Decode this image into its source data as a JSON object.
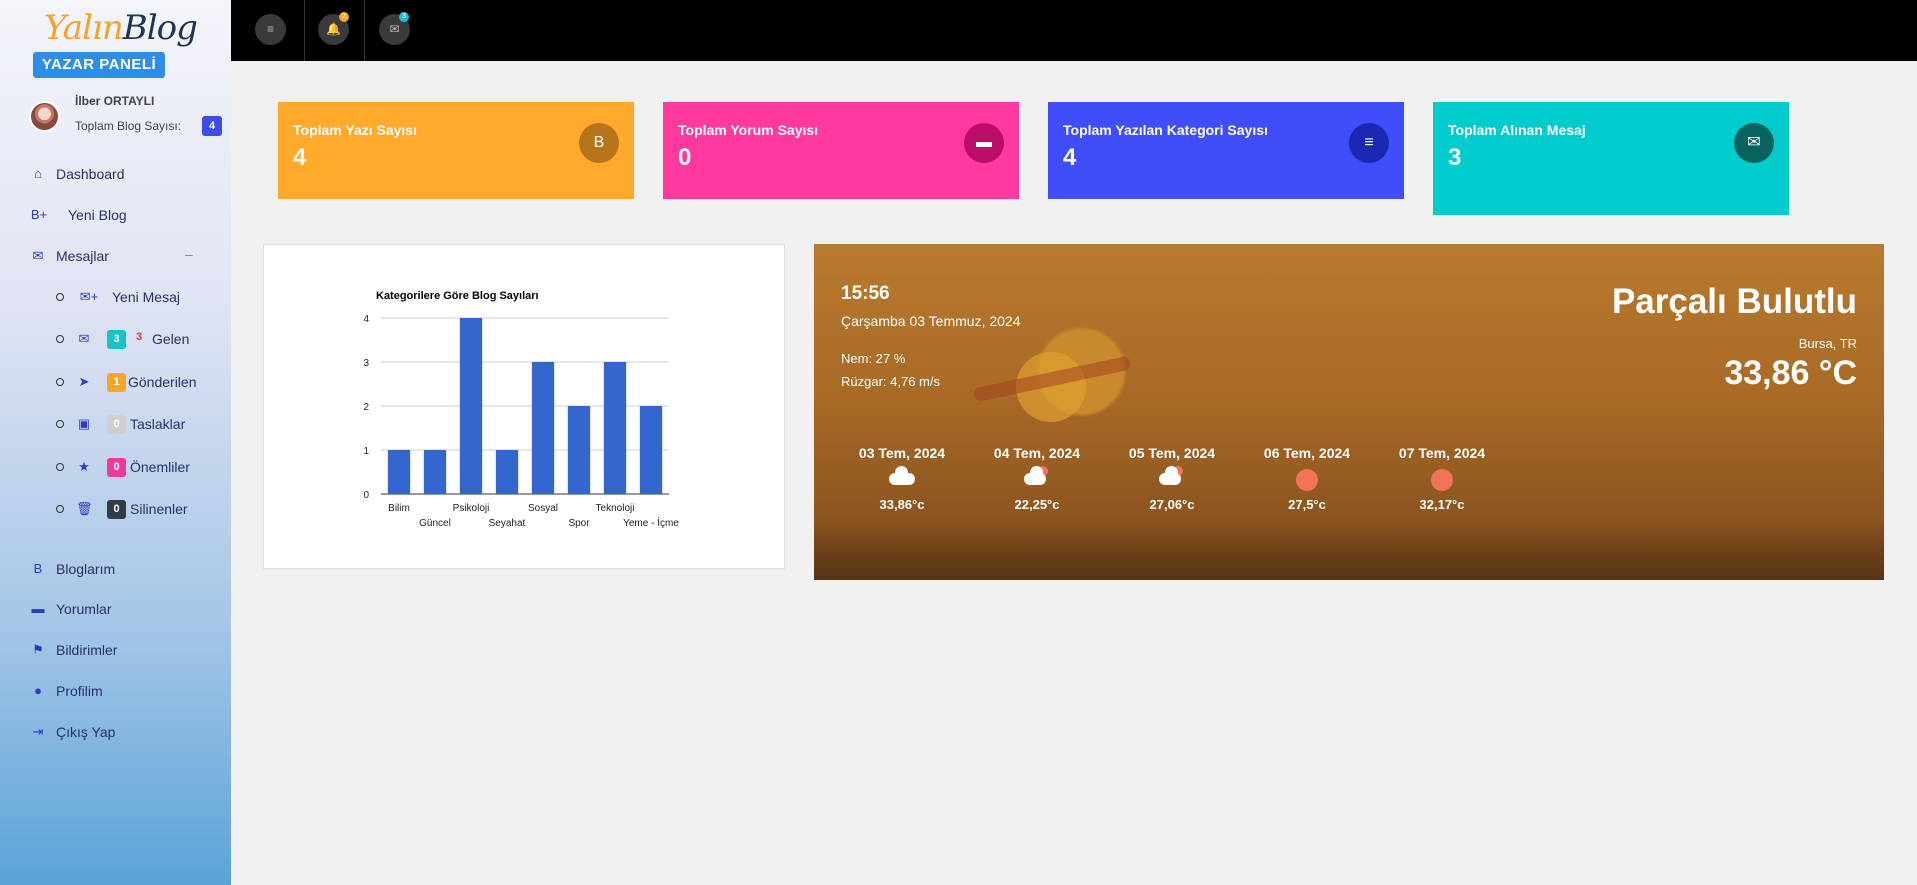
{
  "sidebar": {
    "logo_main": "Yalın",
    "logo_accent": "Blog",
    "panel_label": "YAZAR PANELİ",
    "user_name": "İlber ORTAYLI",
    "blog_count_label": "Toplam Blog Sayısı:",
    "blog_count": "4",
    "menu": [
      {
        "label": "Dashboard",
        "icon": "home-icon"
      },
      {
        "label": "Yeni Blog",
        "icon": "blogger-plus-icon"
      },
      {
        "label": "Mesajlar",
        "icon": "envelope-icon",
        "collapse": "–"
      }
    ],
    "sub_menu": [
      {
        "label": "Yeni Mesaj",
        "icon": "mail-plus-icon"
      },
      {
        "label": "Gelen",
        "icon": "inbox-icon",
        "badge": "3",
        "extra": "3",
        "badge_color": "#18c2c8"
      },
      {
        "label": "Gönderilen",
        "icon": "send-icon",
        "badge": "1",
        "badge_color": "#f5a623"
      },
      {
        "label": "Taslaklar",
        "icon": "save-icon",
        "badge": "0",
        "badge_color": "#cfcfcf"
      },
      {
        "label": "Önemliler",
        "icon": "star-icon",
        "badge": "0",
        "badge_color": "#f0399a"
      },
      {
        "label": "Silinenler",
        "icon": "trash-icon",
        "badge": "0",
        "badge_color": "#333b44"
      }
    ],
    "menu2": [
      {
        "label": "Bloglarım",
        "icon": "blogger-icon"
      },
      {
        "label": "Yorumlar",
        "icon": "comment-icon"
      },
      {
        "label": "Bildirimler",
        "icon": "flag-icon"
      },
      {
        "label": "Profilim",
        "icon": "user-icon"
      },
      {
        "label": "Çıkış Yap",
        "icon": "logout-icon"
      }
    ]
  },
  "topbar": {
    "notification_count": "2",
    "message_count": "3"
  },
  "cards": [
    {
      "title": "Toplam Yazı Sayısı",
      "value": "4",
      "icon": "blogger-icon",
      "color": "#ffaa2b",
      "icon_bg": "#b8741d"
    },
    {
      "title": "Toplam Yorum Sayısı",
      "value": "0",
      "icon": "comment-icon",
      "color": "#ff399e",
      "icon_bg": "#bb0d68"
    },
    {
      "title": "Toplam Yazılan Kategori Sayısı",
      "value": "4",
      "icon": "list-icon",
      "color": "#3f4ef8",
      "icon_bg": "#1d28b2"
    },
    {
      "title": "Toplam Alınan Mesaj",
      "value": "3",
      "icon": "envelope-icon",
      "color": "#00cccd",
      "icon_bg": "#08635f"
    }
  ],
  "chart_data": {
    "type": "bar",
    "title": "Kategorilere Göre Blog Sayıları",
    "categories": [
      "Bilim",
      "Güncel",
      "Psikoloji",
      "Seyahat",
      "Sosyal",
      "Spor",
      "Teknoloji",
      "Yeme - İçme"
    ],
    "values": [
      1,
      1,
      4,
      1,
      3,
      2,
      3,
      2
    ],
    "ylim": [
      0,
      4
    ],
    "yticks": [
      "0",
      "1",
      "2",
      "3",
      "4"
    ],
    "bar_color": "#3366cc",
    "grid": true
  },
  "weather": {
    "time": "15:56",
    "date": "Çarşamba 03 Temmuz, 2024",
    "humidity": "Nem: 27 %",
    "wind": "Rüzgar: 4,76 m/s",
    "condition": "Parçalı Bulutlu",
    "location": "Bursa, TR",
    "temperature": "33,86 °C",
    "forecast": [
      {
        "date": "03 Tem, 2024",
        "temp": "33,86°c",
        "icon": "cloud-icon"
      },
      {
        "date": "04 Tem, 2024",
        "temp": "22,25°c",
        "icon": "partly-cloudy-icon"
      },
      {
        "date": "05 Tem, 2024",
        "temp": "27,06°c",
        "icon": "partly-cloudy-icon"
      },
      {
        "date": "06 Tem, 2024",
        "temp": "27,5°c",
        "icon": "sun-icon"
      },
      {
        "date": "07 Tem, 2024",
        "temp": "32,17°c",
        "icon": "sun-icon"
      }
    ]
  }
}
